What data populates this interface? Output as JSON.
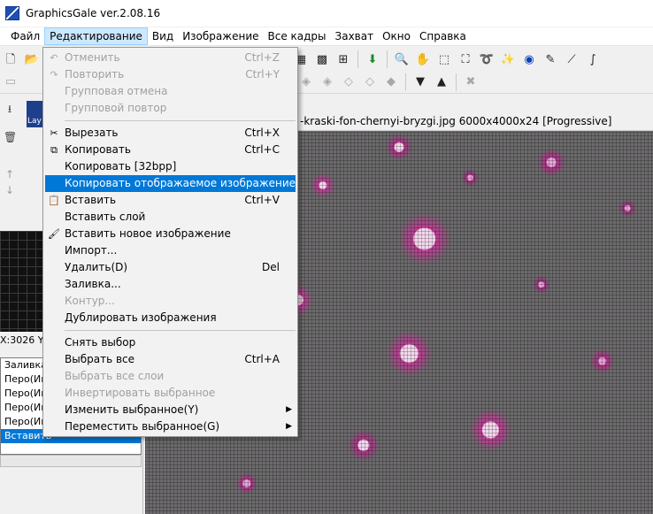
{
  "window": {
    "title": "GraphicsGale ver.2.08.16"
  },
  "menubar": {
    "items": [
      "Файл",
      "Редактирование",
      "Вид",
      "Изображение",
      "Все кадры",
      "Захват",
      "Окно",
      "Справка"
    ]
  },
  "document": {
    "title": "-kraski-fon-chernyi-bryzgi.jpg 6000x4000x24 [Progressive]"
  },
  "left_panel": {
    "layer_label": "Lay",
    "coords": "X:3026 Y:",
    "history": [
      "Заливка",
      "Перо(Ин",
      "Перо(Ин",
      "Перо(Ин",
      "Перо(Ин",
      "Вставить"
    ]
  },
  "edit_menu": {
    "undo": {
      "label": "Отменить",
      "shortcut": "Ctrl+Z"
    },
    "redo": {
      "label": "Повторить",
      "shortcut": "Ctrl+Y"
    },
    "group_undo": {
      "label": "Групповая отмена"
    },
    "group_redo": {
      "label": "Групповой повтор"
    },
    "cut": {
      "label": "Вырезать",
      "shortcut": "Ctrl+X"
    },
    "copy": {
      "label": "Копировать",
      "shortcut": "Ctrl+C"
    },
    "copy32": {
      "label": "Копировать [32bpp]"
    },
    "copy_displayed": {
      "label": "Копировать отображаемое изображение"
    },
    "paste": {
      "label": "Вставить",
      "shortcut": "Ctrl+V"
    },
    "paste_layer": {
      "label": "Вставить слой"
    },
    "paste_new": {
      "label": "Вставить новое изображение"
    },
    "import": {
      "label": "Импорт..."
    },
    "delete": {
      "label": "Удалить(D)",
      "shortcut": "Del"
    },
    "fill": {
      "label": "Заливка..."
    },
    "outline": {
      "label": "Контур..."
    },
    "duplicate": {
      "label": "Дублировать изображения"
    },
    "deselect": {
      "label": "Снять выбор"
    },
    "select_all": {
      "label": "Выбрать все",
      "shortcut": "Ctrl+A"
    },
    "select_all_layers": {
      "label": "Выбрать все слои"
    },
    "invert_selection": {
      "label": "Инвертировать выбранное"
    },
    "modify_selection": {
      "label": "Изменить выбранное(Y)"
    },
    "move_selection": {
      "label": "Переместить выбранное(G)"
    }
  },
  "colors": {
    "menu_highlight": "#0078d7",
    "canvas_accent": "#c13a96"
  }
}
